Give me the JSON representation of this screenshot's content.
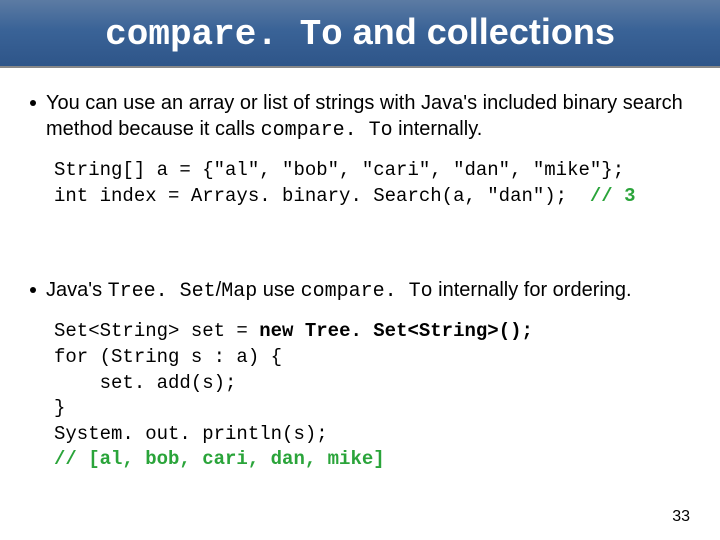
{
  "title": {
    "code": "compare. To",
    "rest": " and collections"
  },
  "bullet1": {
    "pre": "You can use an array or list of strings with Java's included binary search method because it calls ",
    "code": "compare. To",
    "post": " internally."
  },
  "code1": {
    "line1": "String[] a = {\"al\", \"bob\", \"cari\", \"dan\", \"mike\"};",
    "line2a": "int index = Arrays. binary. Search(a, \"dan\");  ",
    "line2b": "// 3"
  },
  "bullet2": {
    "pre": "Java's ",
    "code1": "Tree. Set",
    "mid1": "/",
    "code2": "Map",
    "mid2": " use ",
    "code3": "compare. To",
    "post": " internally for ordering."
  },
  "code2": {
    "line1a": "Set<String> set = ",
    "line1b": "new",
    "line1c": " ",
    "line1d": "Tree. Set<String>();",
    "line2": "for (String s : a) {",
    "line3": "    set. add(s);",
    "line4": "}",
    "line5": "System. out. println(s);",
    "line6": "// [al, bob, cari, dan, mike]"
  },
  "page_number": "33"
}
